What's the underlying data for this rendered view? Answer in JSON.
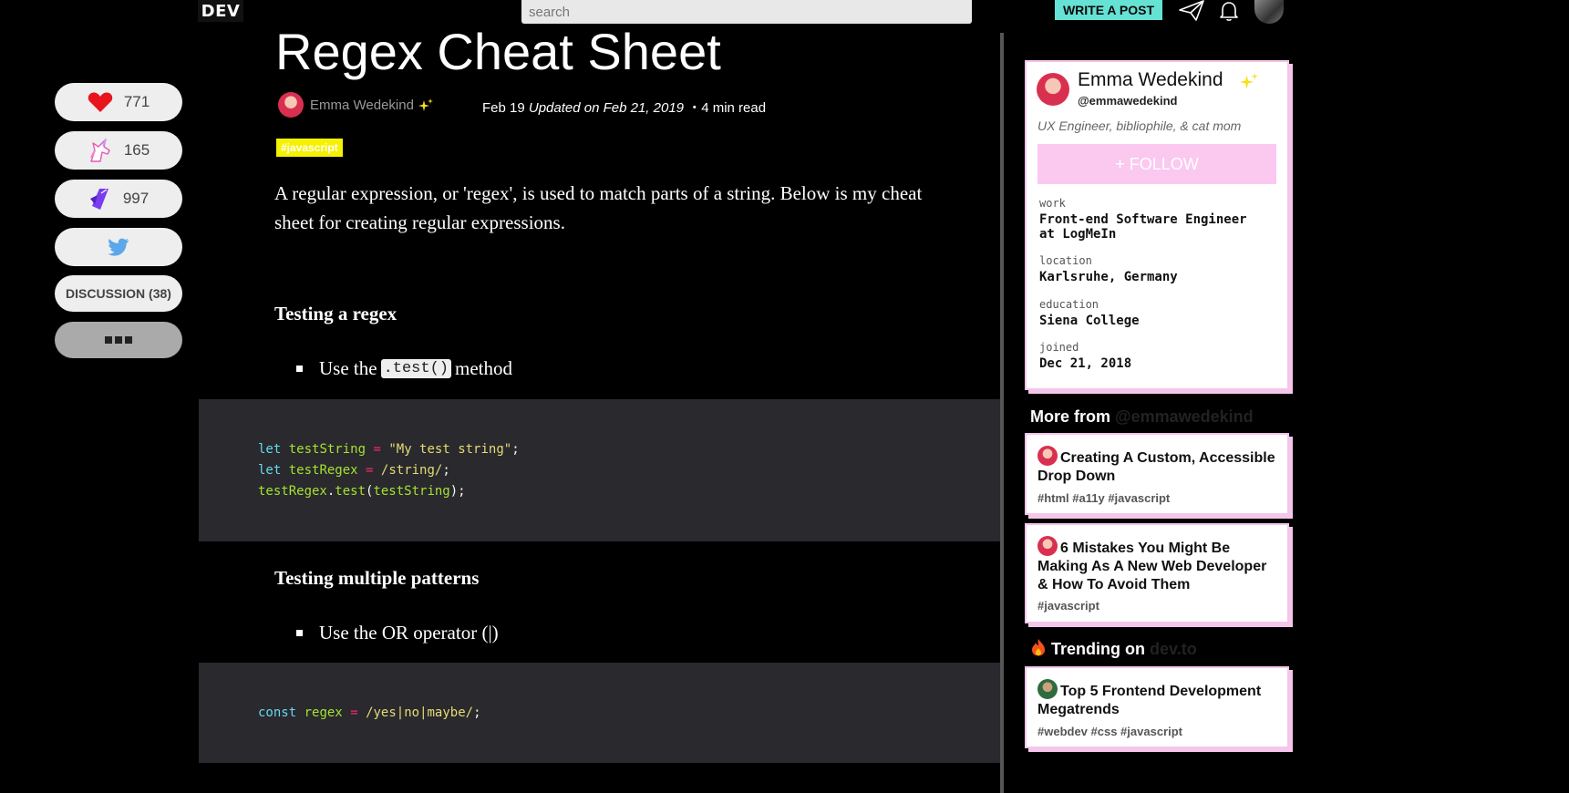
{
  "header": {
    "logo": "DEV",
    "search_placeholder": "search",
    "write_post_label": "WRITE A POST",
    "icons": [
      "paper-plane-icon",
      "bell-icon"
    ]
  },
  "reactions": {
    "hearts": "771",
    "unicorns": "165",
    "bookmarks": "997",
    "discussion_label": "DISCUSSION (38)",
    "more_icon": "ellipsis-icon"
  },
  "article": {
    "title": "Regex Cheat Sheet",
    "author": "Emma Wedekind",
    "date": "Feb 19",
    "updated": "Updated on Feb 21, 2019",
    "read_time": "・4 min read",
    "tag": "#javascript",
    "intro": "A regular expression, or 'regex', is used to match parts of a string. Below is my cheat sheet for creating regular expressions.",
    "sections": [
      {
        "heading": "Testing a regex",
        "bullet_before": "Use the",
        "bullet_code": ".test()",
        "bullet_after": "method"
      },
      {
        "heading": "Testing multiple patterns",
        "bullet": "Use the OR operator (|)"
      }
    ]
  },
  "profile": {
    "name": "Emma Wedekind",
    "handle": "@emmawedekind",
    "bio": "UX Engineer, bibliophile, & cat mom",
    "follow_label": "+ FOLLOW",
    "work_label": "work",
    "work": "Front-end Software Engineer at LogMeIn",
    "location_label": "location",
    "location": "Karlsruhe, Germany",
    "education_label": "education",
    "education": "Siena College",
    "joined_label": "joined",
    "joined": "Dec 21, 2018"
  },
  "more_from": {
    "label": "More from",
    "handle": "@emmawedekind",
    "posts": [
      {
        "title": "Creating A Custom, Accessible Drop Down",
        "tags": "#html #a11y #javascript"
      },
      {
        "title": "6 Mistakes You Might Be Making As A New Web Developer & How To Avoid Them",
        "tags": "#javascript"
      }
    ]
  },
  "trending": {
    "label": "Trending on",
    "site": "dev.to",
    "posts": [
      {
        "title": "Top 5 Frontend Development Megatrends",
        "tags": "#webdev #css #javascript"
      }
    ]
  },
  "colors": {
    "accent_teal": "#66e2d5",
    "tag_yellow": "#f5f100",
    "card_pink": "#f4c6ea",
    "code_bg": "#29292e"
  }
}
